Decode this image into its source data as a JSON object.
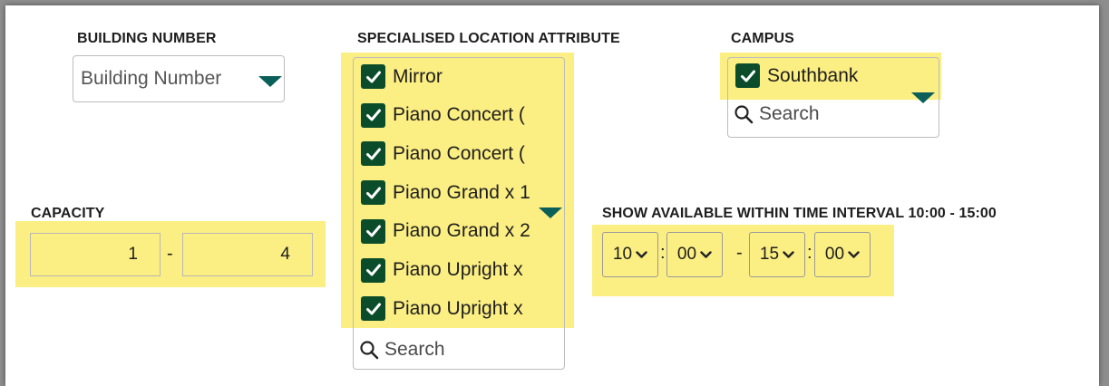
{
  "building": {
    "label": "BUILDING NUMBER",
    "placeholder": "Building Number"
  },
  "specialised": {
    "label": "SPECIALISED LOCATION ATTRIBUTE",
    "options": [
      {
        "text": "Mirror",
        "checked": true
      },
      {
        "text": "Piano Concert (",
        "checked": true
      },
      {
        "text": "Piano Concert (",
        "checked": true
      },
      {
        "text": "Piano Grand x 1",
        "checked": true
      },
      {
        "text": "Piano Grand x 2",
        "checked": true
      },
      {
        "text": "Piano Upright x",
        "checked": true
      },
      {
        "text": "Piano Upright x",
        "checked": true
      }
    ],
    "search_placeholder": "Search"
  },
  "campus": {
    "label": "CAMPUS",
    "options": [
      {
        "text": "Southbank",
        "checked": true
      }
    ],
    "search_placeholder": "Search"
  },
  "capacity": {
    "label": "CAPACITY",
    "min": "1",
    "separator": "-",
    "max": "4"
  },
  "time": {
    "label": "SHOW AVAILABLE WITHIN TIME INTERVAL 10:00 - 15:00",
    "start_hour": "10",
    "start_minute": "00",
    "end_hour": "15",
    "end_minute": "00",
    "colon": ":",
    "dash": "-"
  },
  "colors": {
    "highlight": "#fbee82",
    "checkbox": "#0b4d2a",
    "caret": "#0b5f59"
  },
  "icons": {
    "check": "check-icon",
    "search": "search-icon",
    "caret": "caret-down-icon",
    "chevron": "chevron-down-icon"
  }
}
